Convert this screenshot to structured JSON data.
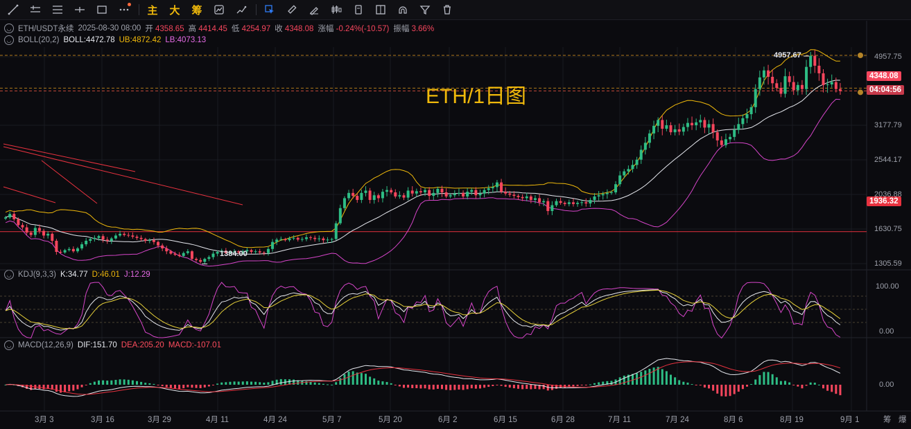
{
  "toolbar": {
    "cn_main": "主",
    "cn_big": "大",
    "cn_chip": "筹"
  },
  "info": {
    "symbol": "ETH/USDT永续",
    "date": "2025-08-30 08:00",
    "open_label": "开",
    "open": "4358.65",
    "high_label": "高",
    "high": "4414.45",
    "low_label": "低",
    "low": "4254.97",
    "close_label": "收",
    "close": "4348.08",
    "change_label": "涨幅",
    "change": "-0.24%(-10.57)",
    "amp_label": "振幅",
    "amp": "3.66%"
  },
  "boll": {
    "name": "BOLL(20,2)",
    "mid": "BOLL:4472.78",
    "ub": "UB:4872.42",
    "lb": "LB:4073.13"
  },
  "kdj": {
    "name": "KDJ(9,3,3)",
    "k": "K:34.77",
    "d": "D:46.01",
    "j": "J:12.29"
  },
  "macd": {
    "name": "MACD(12,26,9)",
    "dif": "DIF:151.70",
    "dea": "DEA:205.20",
    "macd": "MACD:-107.01"
  },
  "watermark": "ETH/1日图",
  "price_axis": [
    "4957.75",
    "3177.79",
    "2544.17",
    "2036.88",
    "1630.75",
    "1305.59"
  ],
  "kdj_axis": [
    "100.00",
    "0.00"
  ],
  "macd_axis": [
    "0.00"
  ],
  "last_price": "4348.08",
  "countdown": "04:04:56",
  "line_price": "1936.32",
  "high_mark": "4957.67",
  "low_mark": "1384.00",
  "time_axis": [
    "3月 3",
    "3月 16",
    "3月 29",
    "4月 11",
    "4月 24",
    "5月 7",
    "5月 20",
    "6月 2",
    "6月 15",
    "6月 28",
    "7月 11",
    "7月 24",
    "8月 6",
    "8月 19",
    "9月 1"
  ],
  "corner_labels": [
    "筹",
    "爆"
  ],
  "colors": {
    "up": "#2ebd85",
    "down": "#f6465d",
    "accent": "#f0b90b",
    "boll_mid": "#e6e8ee",
    "boll_ub": "#f0b90b",
    "boll_lb": "#d645c9"
  },
  "chart_data": {
    "type": "candlestick",
    "closes": [
      2180,
      2240,
      2150,
      2050,
      2010,
      1920,
      1880,
      2000,
      1950,
      1870,
      1900,
      1780,
      1590,
      1580,
      1620,
      1640,
      1600,
      1650,
      1720,
      1780,
      1810,
      1830,
      1860,
      1800,
      1780,
      1820,
      1870,
      1900,
      1880,
      1870,
      1850,
      1830,
      1810,
      1780,
      1790,
      1760,
      1700,
      1650,
      1600,
      1560,
      1540,
      1520,
      1570,
      1600,
      1470,
      1450,
      1420,
      1470,
      1500,
      1560,
      1590,
      1610,
      1570,
      1590,
      1600,
      1580,
      1600,
      1620,
      1590,
      1600,
      1580,
      1570,
      1640,
      1760,
      1800,
      1810,
      1790,
      1820,
      1830,
      1800,
      1810,
      1840,
      1830,
      1810,
      1820,
      1790,
      1800,
      1810,
      2080,
      2340,
      2510,
      2600,
      2550,
      2480,
      2600,
      2640,
      2480,
      2560,
      2510,
      2620,
      2650,
      2610,
      2540,
      2560,
      2520,
      2640,
      2590,
      2630,
      2610,
      2650,
      2550,
      2600,
      2670,
      2610,
      2540,
      2560,
      2590,
      2600,
      2540,
      2620,
      2650,
      2560,
      2590,
      2650,
      2680,
      2700,
      2780,
      2620,
      2590,
      2570,
      2550,
      2530,
      2510,
      2540,
      2480,
      2510,
      2440,
      2460,
      2290,
      2390,
      2460,
      2430,
      2410,
      2440,
      2410,
      2430,
      2440,
      2420,
      2480,
      2540,
      2560,
      2580,
      2600,
      2610,
      2750,
      2900,
      2970,
      3010,
      3080,
      3170,
      3340,
      3460,
      3620,
      3750,
      3850,
      3700,
      3760,
      3640,
      3690,
      3650,
      3730,
      3800,
      3760,
      3810,
      3850,
      3720,
      3780,
      3640,
      3500,
      3420,
      3520,
      3560,
      3680,
      3780,
      3880,
      3950,
      4070,
      4380,
      4580,
      4700,
      4590,
      4480,
      4400,
      4300,
      4600,
      4500,
      4360,
      4450,
      4380,
      4760,
      4950,
      4780,
      4650,
      4450,
      4460,
      4500,
      4380,
      4348
    ],
    "ylim": [
      1305.59,
      4957.75
    ],
    "high_mark": 4957.67,
    "low_mark": 1384.0,
    "line_price": 1936.32,
    "last_price": 4348.08,
    "kdj": {
      "k": 34.77,
      "d": 46.01,
      "j": 12.29,
      "ylim": [
        0,
        100
      ]
    },
    "macd": {
      "dif": 151.7,
      "dea": 205.2,
      "macd": -107.01
    }
  }
}
